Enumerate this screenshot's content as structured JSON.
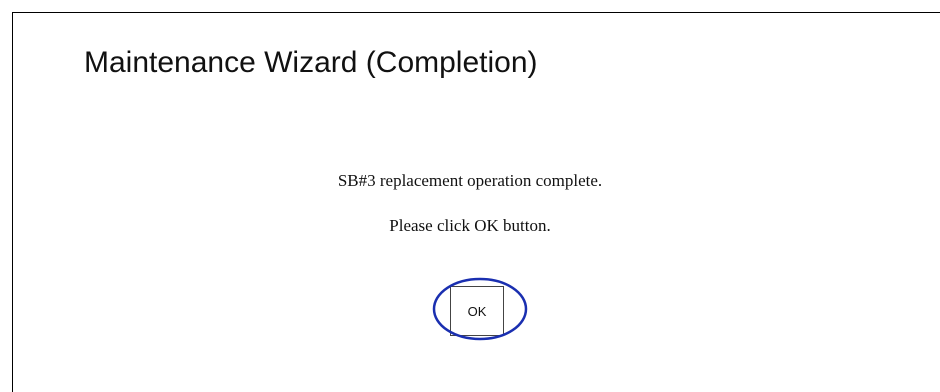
{
  "dialog": {
    "title": "Maintenance Wizard (Completion)",
    "message_line1": "SB#3 replacement operation complete.",
    "message_line2": "Please click OK button.",
    "ok_label": "OK"
  },
  "colors": {
    "highlight": "#1a2fb0",
    "text": "#111111",
    "border": "#000000"
  }
}
